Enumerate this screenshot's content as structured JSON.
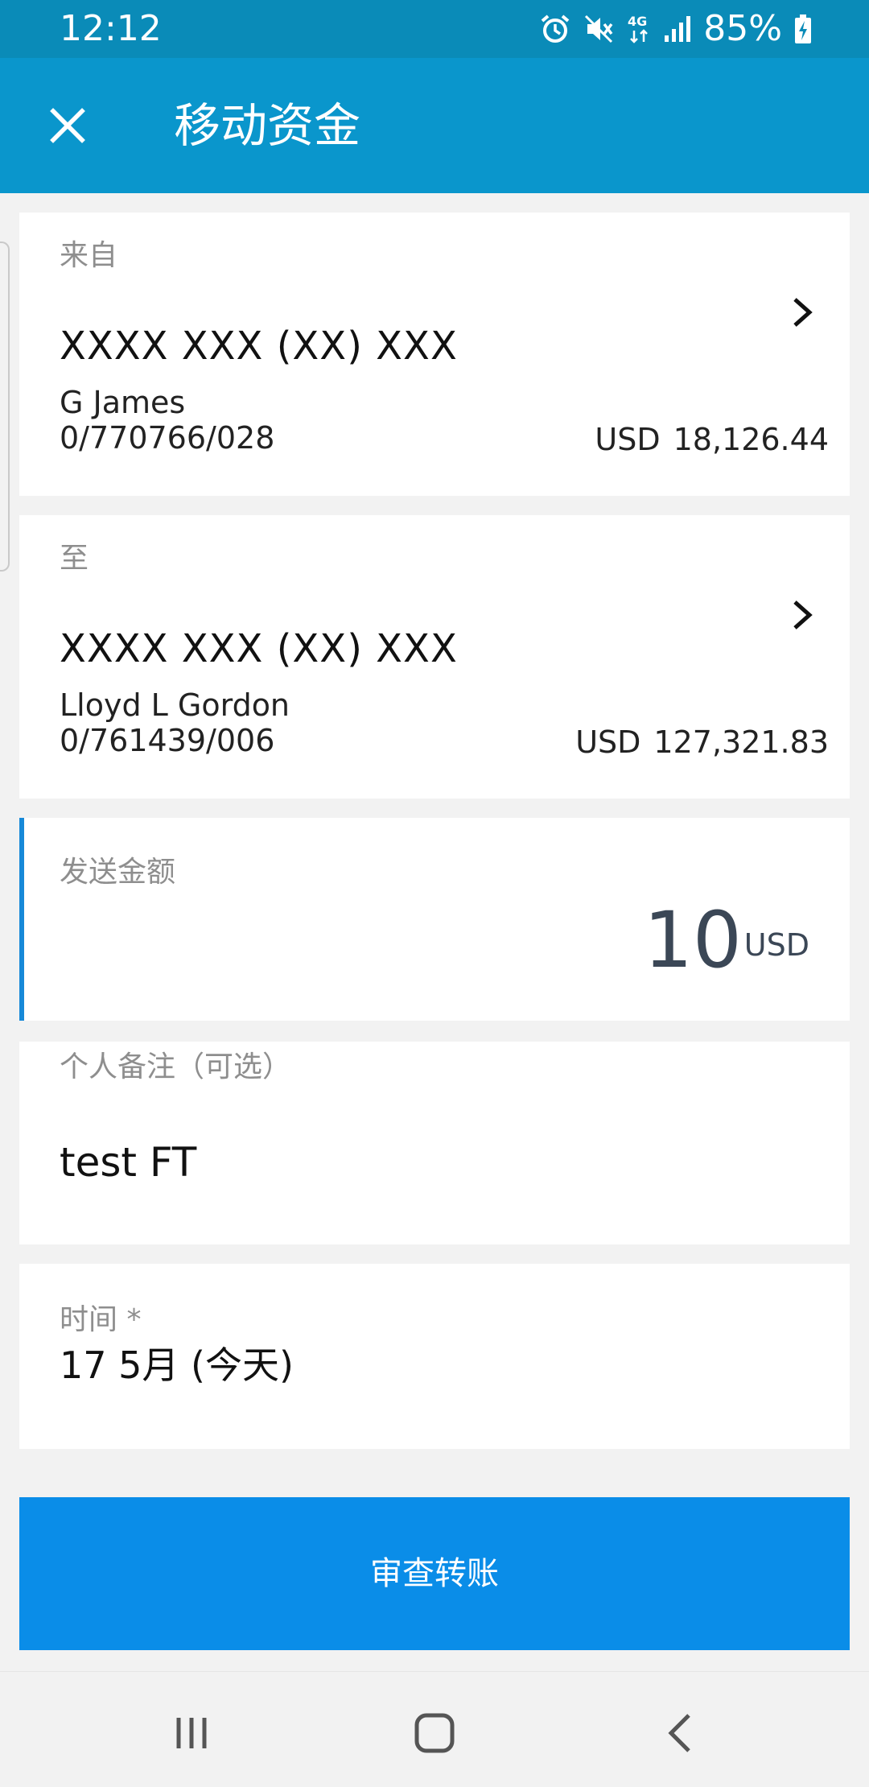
{
  "status_bar": {
    "time": "12:12",
    "battery_percent": "85%",
    "network": "4G",
    "icons": [
      "alarm-icon",
      "mute-icon",
      "network-4g-icon",
      "signal-icon",
      "battery-charging-icon"
    ]
  },
  "header": {
    "title": "移动资金",
    "close_icon": "close-icon"
  },
  "from": {
    "label": "来自",
    "account_mask": "XXXX XXX (XX) XXX",
    "name": "G James",
    "account_number": "0/770766/028",
    "currency": "USD",
    "balance": "18,126.44"
  },
  "to": {
    "label": "至",
    "account_mask": "XXXX XXX (XX) XXX",
    "name": "Lloyd L Gordon",
    "account_number": "0/761439/006",
    "currency": "USD",
    "balance": "127,321.83"
  },
  "amount": {
    "label": "发送金额",
    "value": "10",
    "currency": "USD"
  },
  "memo": {
    "label": "个人备注（可选）",
    "value": "test FT"
  },
  "date": {
    "label": "时间 *",
    "value": "17 5月 (今天)"
  },
  "review_button": {
    "label": "审查转账"
  },
  "nav_bar": {
    "icons": [
      "recent-apps-icon",
      "home-icon",
      "back-icon"
    ]
  },
  "colors": {
    "status_bar": "#0a8bb8",
    "app_bar": "#0a96cc",
    "primary_button": "#0a8de8",
    "accent": "#1789d8",
    "background": "#f2f2f2",
    "label_gray": "#8e8e8e",
    "amount_text": "#3b4756"
  }
}
